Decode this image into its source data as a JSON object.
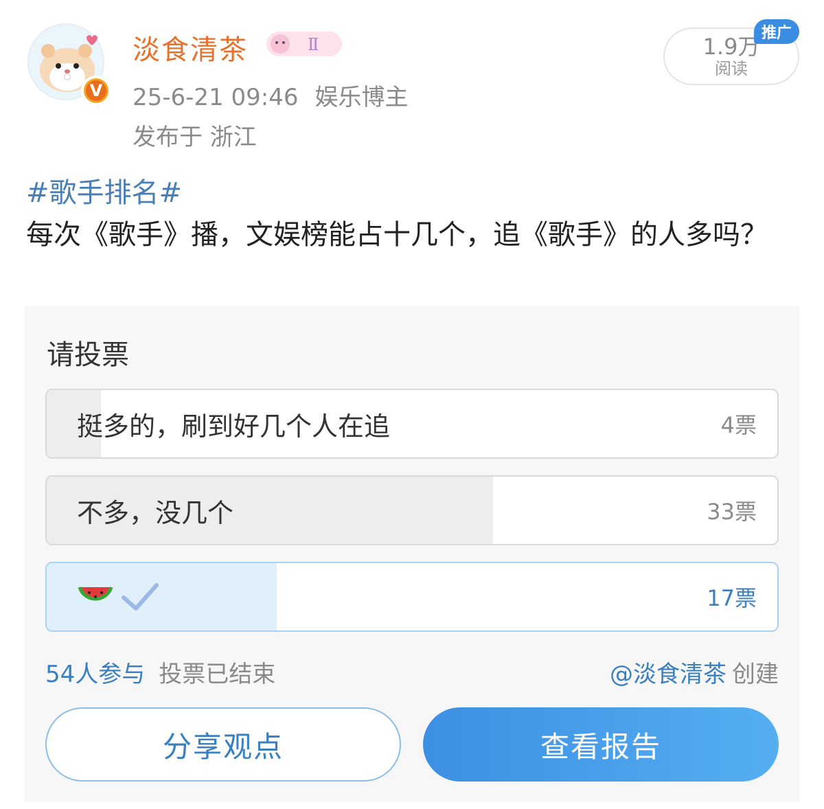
{
  "post": {
    "username": "淡食清茶",
    "level_badge": "Ⅱ",
    "time": "25-6-21 09:46",
    "role": "娱乐博主",
    "location": "发布于 浙江",
    "reads_count": "1.9万",
    "reads_label": "阅读",
    "promo_label": "推广",
    "hashtag": "#歌手排名#",
    "text": "每次《歌手》播，文娱榜能占十几个，追《歌手》的人多吗？"
  },
  "poll": {
    "title": "请投票",
    "options": [
      {
        "label": "挺多的，刷到好几个人在追",
        "votes": "4票",
        "fraction": 0.074
      },
      {
        "label": "不多，没几个",
        "votes": "33票",
        "fraction": 0.611
      },
      {
        "label": "",
        "votes": "17票",
        "fraction": 0.315,
        "icons": [
          "watermelon-icon",
          "checkmark-icon"
        ]
      }
    ],
    "participants": "54人参与",
    "status": "投票已结束",
    "creator": "@淡食清茶",
    "create_label": "创建",
    "share_button": "分享观点",
    "report_button": "查看报告"
  },
  "colors": {
    "username": "#e8712d",
    "link": "#3a7fc0",
    "hashtag": "#4a7fb5",
    "report_button": "#3c8fe3"
  }
}
